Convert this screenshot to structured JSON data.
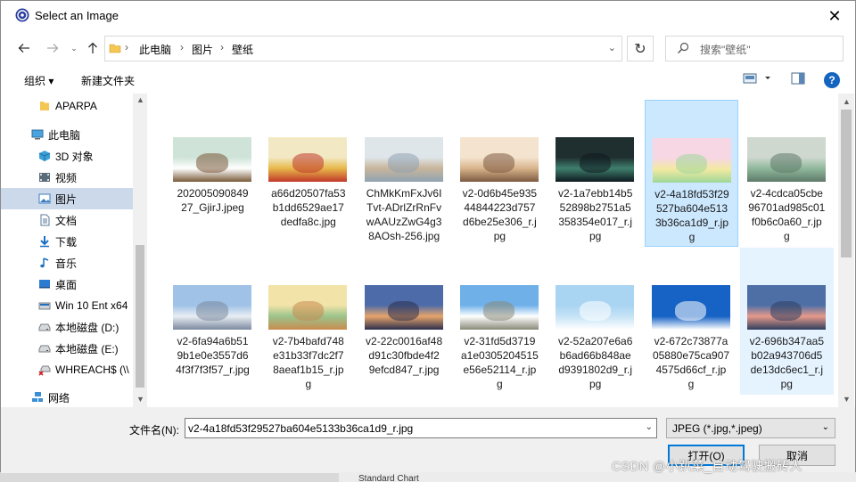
{
  "window": {
    "title": "Select an Image"
  },
  "address": {
    "crumbs": [
      "此电脑",
      "图片",
      "壁纸"
    ],
    "search_placeholder": "搜索\"壁纸\""
  },
  "toolbar": {
    "organize": "组织 ▾",
    "new_folder": "新建文件夹"
  },
  "sidebar": {
    "items": [
      {
        "label": "APARPA",
        "icon": "folder-icon"
      },
      {
        "label": "此电脑",
        "icon": "computer-icon"
      },
      {
        "label": "3D 对象",
        "icon": "3d-objects-icon"
      },
      {
        "label": "视频",
        "icon": "video-icon"
      },
      {
        "label": "图片",
        "icon": "pictures-icon",
        "selected": true
      },
      {
        "label": "文档",
        "icon": "documents-icon"
      },
      {
        "label": "下载",
        "icon": "download-icon"
      },
      {
        "label": "音乐",
        "icon": "music-icon"
      },
      {
        "label": "桌面",
        "icon": "desktop-icon"
      },
      {
        "label": "Win 10 Ent x64",
        "icon": "drive-icon"
      },
      {
        "label": "本地磁盘 (D:)",
        "icon": "drive-icon"
      },
      {
        "label": "本地磁盘 (E:)",
        "icon": "drive-icon"
      },
      {
        "label": "WHREACH$ (\\\\",
        "icon": "network-drive-icon"
      },
      {
        "label": "网络",
        "icon": "network-icon"
      }
    ]
  },
  "files": [
    {
      "name": "20200509084927_GjirJ.jpeg",
      "lines": [
        "202005090849",
        "27_GjirJ.jpeg"
      ],
      "colors": [
        "#cfe3d8",
        "#ffffff",
        "#7a5a3a"
      ]
    },
    {
      "name": "a66d20507fa53b1dd6529ae17dedfa8c.jpg",
      "lines": [
        "a66d20507fa53",
        "b1dd6529ae17",
        "dedfa8c.jpg"
      ],
      "colors": [
        "#f2e9c4",
        "#e8b84a",
        "#c0392b"
      ]
    },
    {
      "name": "ChMkKmFxJv6ITvt-ADrlZrRnFvwAAUzZwG4g38AOsh-256.jpg",
      "lines": [
        "ChMkKmFxJv6I",
        "Tvt-ADrlZrRnFv",
        "wAAUzZwG4g3",
        "8AOsh-256.jpg"
      ],
      "colors": [
        "#dfe6ea",
        "#c8b59a",
        "#8fa3b3"
      ]
    },
    {
      "name": "v2-0d6b45e93544844223d757d6be25e306_r.jpg",
      "lines": [
        "v2-0d6b45e935",
        "44844223d757",
        "d6be25e306_r.j",
        "pg"
      ],
      "colors": [
        "#f4e4cf",
        "#d8b48c",
        "#7d5a41"
      ]
    },
    {
      "name": "v2-1a7ebb14b552898b2751a5358354e017_r.jpg",
      "lines": [
        "v2-1a7ebb14b5",
        "52898b2751a5",
        "358354e017_r.j",
        "pg"
      ],
      "colors": [
        "#1f2e2f",
        "#3f7f6d",
        "#0e1a1f"
      ]
    },
    {
      "name": "v2-4a18fd53f29527ba604e5133b36ca1d9_r.jpg",
      "lines": [
        "v2-4a18fd53f29",
        "527ba604e513",
        "3b36ca1d9_r.jp",
        "g"
      ],
      "colors": [
        "#f7d7e3",
        "#f3e9a1",
        "#9ed79a"
      ],
      "selected": true
    },
    {
      "name": "v2-4cdca05cbe96701ad985c01f0b6c0a60_r.jpg",
      "lines": [
        "v2-4cdca05cbe",
        "96701ad985c01",
        "f0b6c0a60_r.jp",
        "g"
      ],
      "colors": [
        "#cfd8cf",
        "#8fb89c",
        "#5f7a6a"
      ]
    },
    {
      "name": "v2-6fa94a6b519b1e0e3557d64f3f7f3f57_r.jpg",
      "lines": [
        "v2-6fa94a6b51",
        "9b1e0e3557d6",
        "4f3f7f3f57_r.jpg"
      ],
      "colors": [
        "#9fc2e6",
        "#e9eef3",
        "#7b8aa0"
      ]
    },
    {
      "name": "v2-7b4bafd748e31b33f7dc2f78aeaf1b15_r.jpg",
      "lines": [
        "v2-7b4bafd748",
        "e31b33f7dc2f7",
        "8aeaf1b15_r.jp",
        "g"
      ],
      "colors": [
        "#f2e3a8",
        "#9bc48c",
        "#c98b4f"
      ]
    },
    {
      "name": "v2-22c0016af48d91c30fbde4f29efcd847_r.jpg",
      "lines": [
        "v2-22c0016af48",
        "d91c30fbde4f2",
        "9efcd847_r.jpg"
      ],
      "colors": [
        "#4d6ba8",
        "#e7a46b",
        "#2b2f4d"
      ]
    },
    {
      "name": "v2-31fd5d3719a1e0305204515e56e52114_r.jpg",
      "lines": [
        "v2-31fd5d3719",
        "a1e0305204515",
        "e56e52114_r.jp",
        "g"
      ],
      "colors": [
        "#6fb0e8",
        "#ffffff",
        "#8a8a7a"
      ]
    },
    {
      "name": "v2-52a207e6ab6ad66b848aed9391802d9_r.jpg",
      "lines": [
        "v2-52a207e6a6",
        "b6ad66b848ae",
        "d9391802d9_r.j",
        "pg"
      ],
      "colors": [
        "#a9d4f2",
        "#c5e3f6",
        "#ffffff"
      ]
    },
    {
      "name": "v2-672c73877a05880e75ca9074575d66cf_r.jpg",
      "lines": [
        "v2-672c73877a",
        "05880e75ca907",
        "4575d66cf_r.jp",
        "g"
      ],
      "colors": [
        "#1662c5",
        "#1662c5",
        "#ffffff"
      ]
    },
    {
      "name": "v2-696b347aa5b02a943706d5de13dc6ec1_r.jpg",
      "lines": [
        "v2-696b347aa5",
        "b02a943706d5",
        "de13dc6ec1_r.j",
        "pg"
      ],
      "colors": [
        "#4d6fa6",
        "#e79a8a",
        "#2f3e5e"
      ],
      "hover": true
    }
  ],
  "bottom": {
    "filename_label": "文件名(N):",
    "filename_value": "v2-4a18fd53f29527ba604e5133b36ca1d9_r.jpg",
    "filter_value": "JPEG (*.jpg,*.jpeg)",
    "open_label": "打开(O)",
    "cancel_label": "取消"
  },
  "backdrop": {
    "text": "Standard Chart"
  },
  "watermark": "CSDN @小趴菜_自动驾驶搬砖人"
}
